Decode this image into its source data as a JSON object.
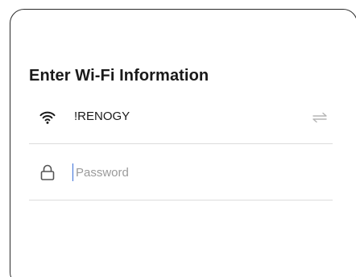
{
  "form": {
    "title": "Enter Wi-Fi Information",
    "network": {
      "name": "!RENOGY",
      "icon": "wifi-icon",
      "action_icon": "switch-network-icon"
    },
    "password": {
      "icon": "lock-icon",
      "value": "",
      "placeholder": "Password"
    }
  },
  "colors": {
    "text": "#1a1a1a",
    "border": "#2a2a2a",
    "divider": "#dcdcdc",
    "placeholder": "#9b9b9b",
    "caret": "#3a6fd8"
  }
}
